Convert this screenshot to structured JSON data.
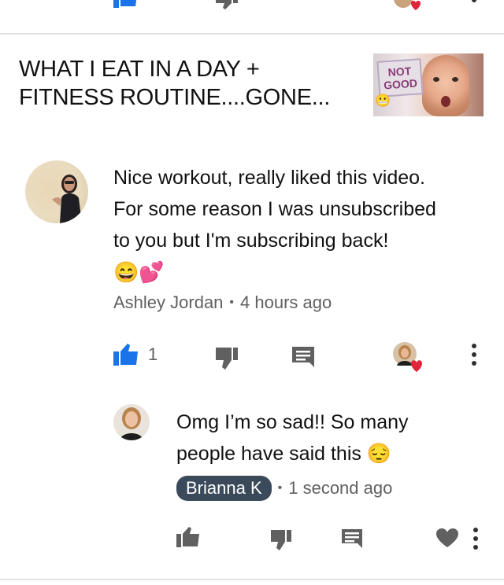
{
  "video": {
    "title_line1": "WHAT I EAT IN A DAY +",
    "title_line2": "FITNESS ROUTINE....GONE...",
    "thumbnail_badge_line1": "NOT",
    "thumbnail_badge_line2": "GOOD"
  },
  "comment": {
    "text_line1": "Nice workout, really liked this video.",
    "text_line2": "For some reason I was unsubscribed",
    "text_line3": "to you but I'm subscribing back!",
    "emojis": "😄💕",
    "author": "Ashley Jordan",
    "time": "4 hours ago",
    "like_count": "1",
    "icons": [
      "thumbs-up-icon",
      "thumbs-down-icon",
      "reply-icon",
      "creator-heart-icon",
      "more-icon"
    ],
    "accent_color": "#1a73e8",
    "heart_color": "#e0243a"
  },
  "reply": {
    "text_line1": "Omg I’m so sad!! So many",
    "text_line2": "people have said this",
    "emoji": "😔",
    "author": "Brianna K",
    "time": "1 second ago",
    "icons": [
      "thumbs-up-icon",
      "thumbs-down-icon",
      "reply-icon",
      "heart-icon",
      "more-icon"
    ]
  },
  "separator": "•"
}
